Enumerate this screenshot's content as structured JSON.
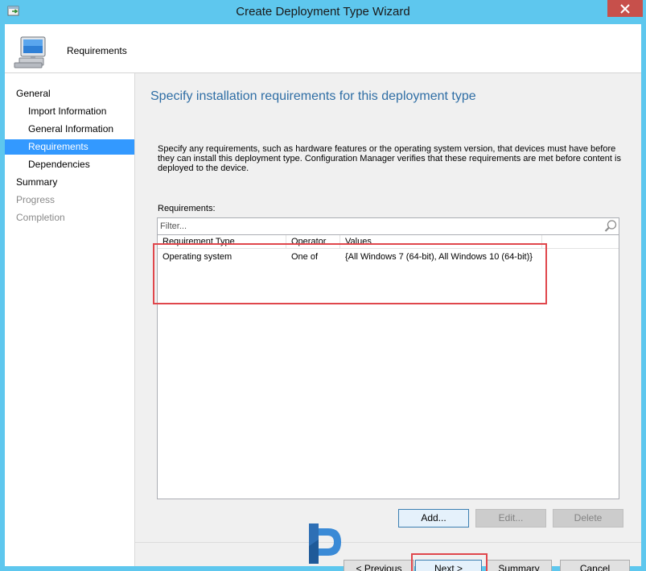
{
  "window": {
    "title": "Create Deployment Type Wizard",
    "close_glyph": "✕",
    "accent_color": "#5ec7ee"
  },
  "header": {
    "title": "Requirements",
    "icon": "computer-icon"
  },
  "nav": {
    "items": [
      {
        "label": "General",
        "level": 0,
        "state": "normal"
      },
      {
        "label": "Import Information",
        "level": 1,
        "state": "normal"
      },
      {
        "label": "General Information",
        "level": 1,
        "state": "normal"
      },
      {
        "label": "Requirements",
        "level": 1,
        "state": "active"
      },
      {
        "label": "Dependencies",
        "level": 1,
        "state": "normal"
      },
      {
        "label": "Summary",
        "level": 0,
        "state": "normal"
      },
      {
        "label": "Progress",
        "level": 0,
        "state": "disabled"
      },
      {
        "label": "Completion",
        "level": 0,
        "state": "disabled"
      }
    ],
    "active_color": "#3399ff"
  },
  "content": {
    "heading": "Specify installation requirements for this deployment type",
    "description": "Specify any requirements, such as hardware features or the operating system version, that devices must have before they can install this deployment type. Configuration Manager verifies that these requirements are met before content is deployed to the device.",
    "requirements_label": "Requirements:",
    "filter_placeholder": "Filter...",
    "table": {
      "columns": [
        "Requirement Type",
        "Operator",
        "Values"
      ],
      "rows": [
        [
          "Operating system",
          "One of",
          "{All Windows 7 (64-bit), All Windows 10 (64-bit)}"
        ]
      ]
    },
    "list_buttons": {
      "add": "Add...",
      "edit": "Edit...",
      "delete": "Delete"
    }
  },
  "footer": {
    "previous": "< Previous",
    "next": "Next >",
    "summary": "Summary",
    "cancel": "Cancel"
  },
  "annotation_color": "#e0474c"
}
